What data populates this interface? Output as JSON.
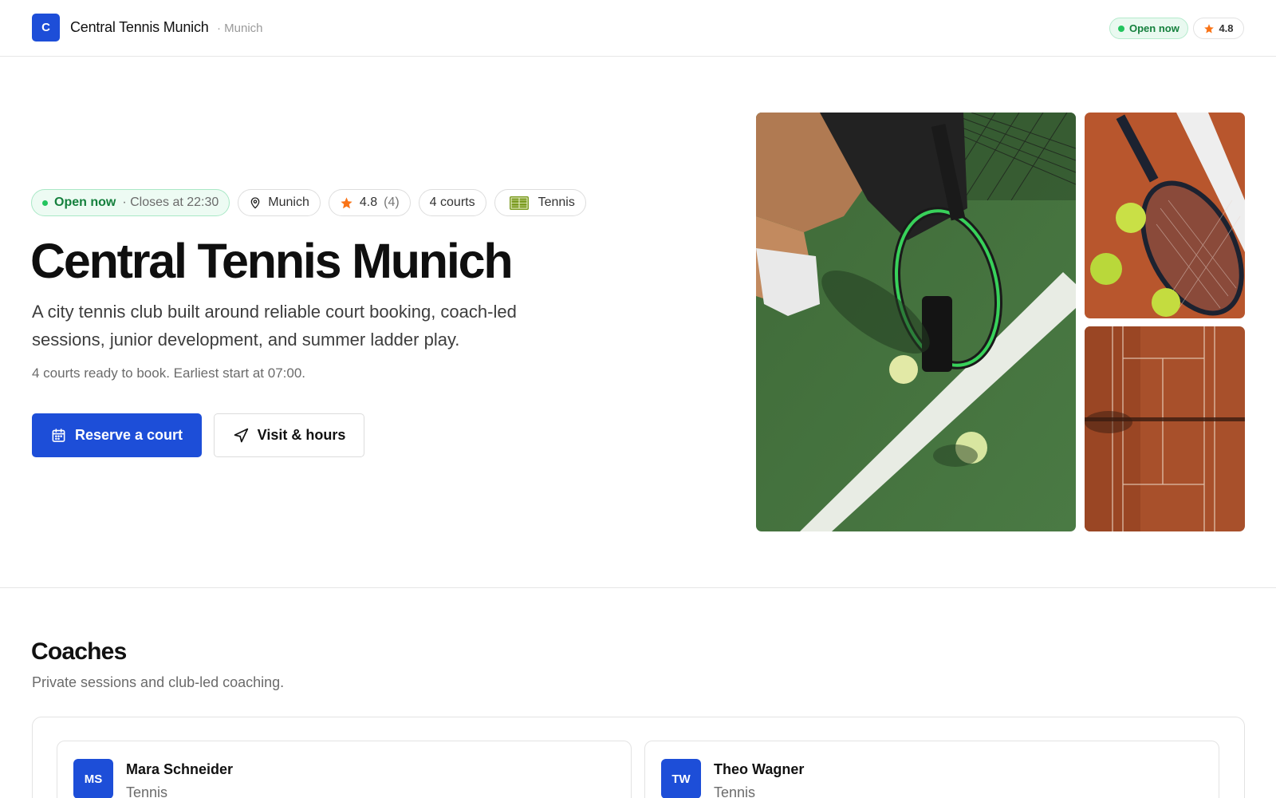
{
  "header": {
    "logo_letter": "C",
    "brand": "Central Tennis Munich",
    "city": "· Munich",
    "open_label": "Open now",
    "rating": "4.8"
  },
  "hero": {
    "chips": {
      "open_label": "Open now",
      "closes": "· Closes at 22:30",
      "location": "Munich",
      "rating": "4.8",
      "rating_count": "(4)",
      "courts": "4 courts",
      "sport": "Tennis"
    },
    "title": "Central Tennis Munich",
    "description": "A city tennis club built around reliable court booking, coach-led sessions, junior development, and summer ladder play.",
    "subtext": "4 courts ready to book. Earliest start at 07:00.",
    "primary_button": "Reserve a court",
    "secondary_button": "Visit & hours"
  },
  "gallery": {
    "images": [
      "player-with-racket-on-green-court",
      "racket-and-balls-on-clay",
      "clay-court-aerial"
    ]
  },
  "coaches": {
    "title": "Coaches",
    "subtitle": "Private sessions and club-led coaching.",
    "items": [
      {
        "initials": "MS",
        "name": "Mara Schneider",
        "sport": "Tennis"
      },
      {
        "initials": "TW",
        "name": "Theo Wagner",
        "sport": "Tennis"
      }
    ]
  },
  "colors": {
    "accent": "#1d4ed8",
    "open_green": "#15803d",
    "star_orange": "#f97316"
  }
}
